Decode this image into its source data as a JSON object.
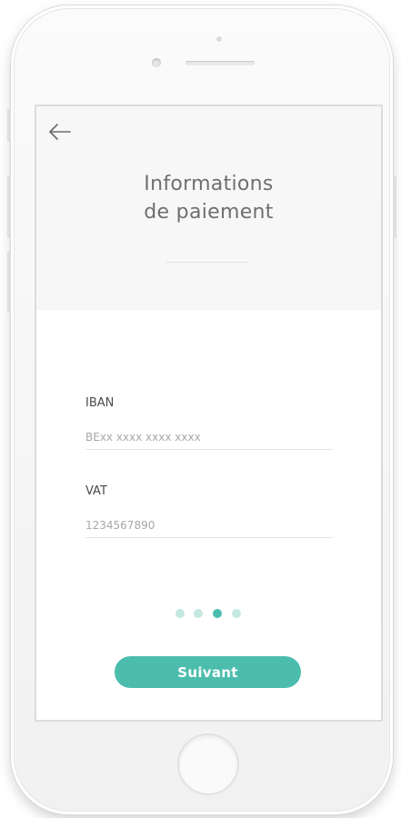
{
  "screen": {
    "header": {
      "back_icon": "arrow-left-icon",
      "title_line1": "Informations",
      "title_line2": "de paiement"
    },
    "form": {
      "iban_label": "IBAN",
      "iban_placeholder": "BExx xxxx xxxx xxxx",
      "vat_label": "VAT",
      "vat_placeholder": "1234567890"
    },
    "stepper": {
      "total_steps": 4,
      "current_step": 3
    },
    "next_button_label": "Suivant"
  },
  "colors": {
    "accent": "#4cbdad",
    "dot_inactive": "#c4e7e2",
    "header_bg": "#f7f7f7",
    "title_text": "#6f6f6f"
  }
}
